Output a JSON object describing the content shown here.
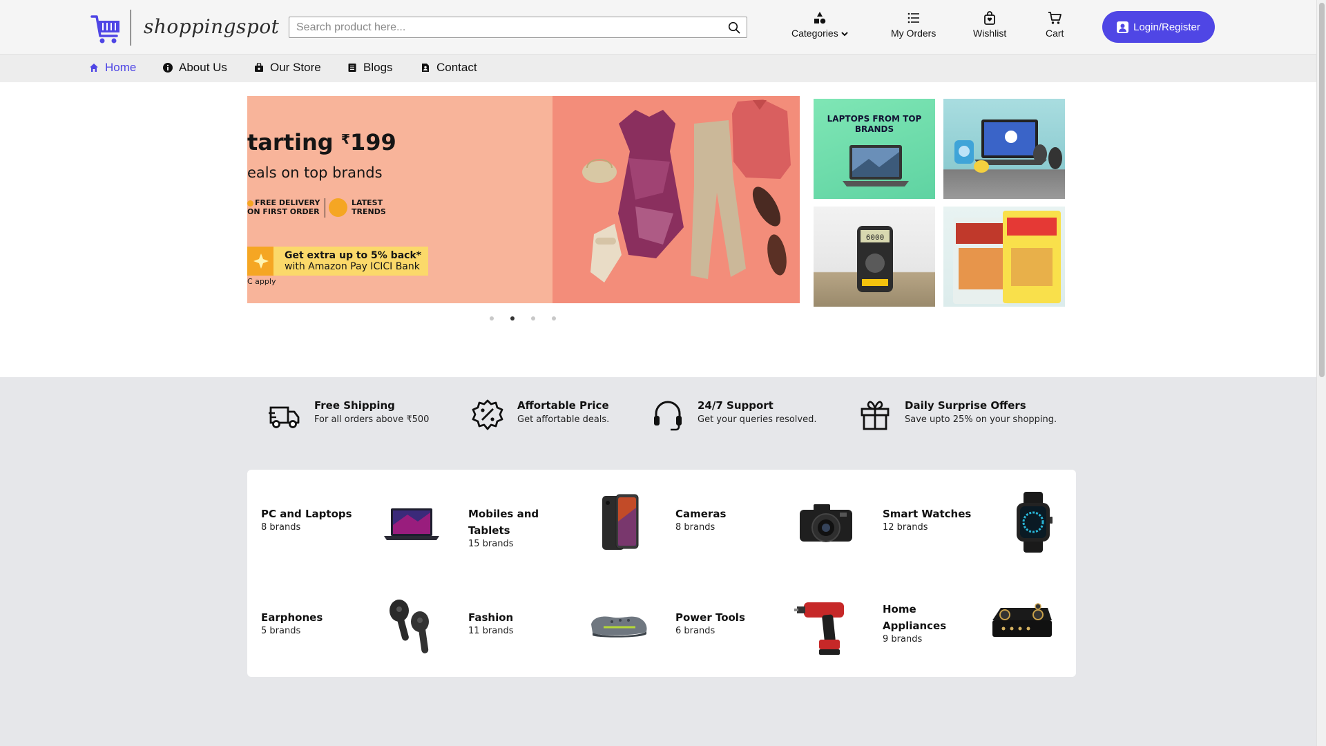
{
  "header": {
    "logo_text": "shoppingspot",
    "search_placeholder": "Search product here...",
    "actions": [
      {
        "label": "Categories",
        "icon": "shapes-icon"
      },
      {
        "label": "My Orders",
        "icon": "list-icon"
      },
      {
        "label": "Wishlist",
        "icon": "bag-icon"
      },
      {
        "label": "Cart",
        "icon": "cart-icon"
      }
    ],
    "login_label": "Login/Register"
  },
  "menu": [
    {
      "label": "Home",
      "icon": "home-icon",
      "active": true
    },
    {
      "label": "About Us",
      "icon": "info-icon"
    },
    {
      "label": "Our Store",
      "icon": "store-icon"
    },
    {
      "label": "Blogs",
      "icon": "blog-icon"
    },
    {
      "label": "Contact",
      "icon": "contact-icon"
    }
  ],
  "hero": {
    "title": "tarting",
    "currency": "₹",
    "price": "199",
    "subtitle": "eals on top brands",
    "badge1": "FREE DELIVERY ON FIRST ORDER",
    "badge2": "LATEST TRENDS",
    "offer_line1": "Get extra up to 5% back*",
    "offer_line2": "with Amazon Pay ICICI Bank",
    "tc": "C apply",
    "slide_count": 4,
    "active_slide": 2
  },
  "tiles": {
    "laptops_caption": "LAPTOPS FROM TOP BRANDS"
  },
  "features": [
    {
      "title": "Free Shipping",
      "subtitle": "For all orders above ₹500",
      "icon": "truck-icon"
    },
    {
      "title": "Affortable Price",
      "subtitle": "Get affortable deals.",
      "icon": "discount-icon"
    },
    {
      "title": "24/7 Support",
      "subtitle": "Get your queries resolved.",
      "icon": "headset-icon"
    },
    {
      "title": "Daily Surprise Offers",
      "subtitle": "Save upto 25% on your shopping.",
      "icon": "gift-icon"
    }
  ],
  "categories": [
    {
      "name": "PC and Laptops",
      "count": "8 brands",
      "icon": "laptop-icon"
    },
    {
      "name": "Mobiles and Tablets",
      "count": "15 brands",
      "icon": "phone-icon"
    },
    {
      "name": "Cameras",
      "count": "8 brands",
      "icon": "camera-icon"
    },
    {
      "name": "Smart Watches",
      "count": "12 brands",
      "icon": "watch-icon"
    },
    {
      "name": "Earphones",
      "count": "5 brands",
      "icon": "earphones-icon"
    },
    {
      "name": "Fashion",
      "count": "11 brands",
      "icon": "shoe-icon"
    },
    {
      "name": "Power Tools",
      "count": "6 brands",
      "icon": "drill-icon"
    },
    {
      "name": "Home Appliances",
      "count": "9 brands",
      "icon": "stove-icon"
    }
  ],
  "colors": {
    "accent": "#4f46e5",
    "band": "#e6e7ea"
  }
}
